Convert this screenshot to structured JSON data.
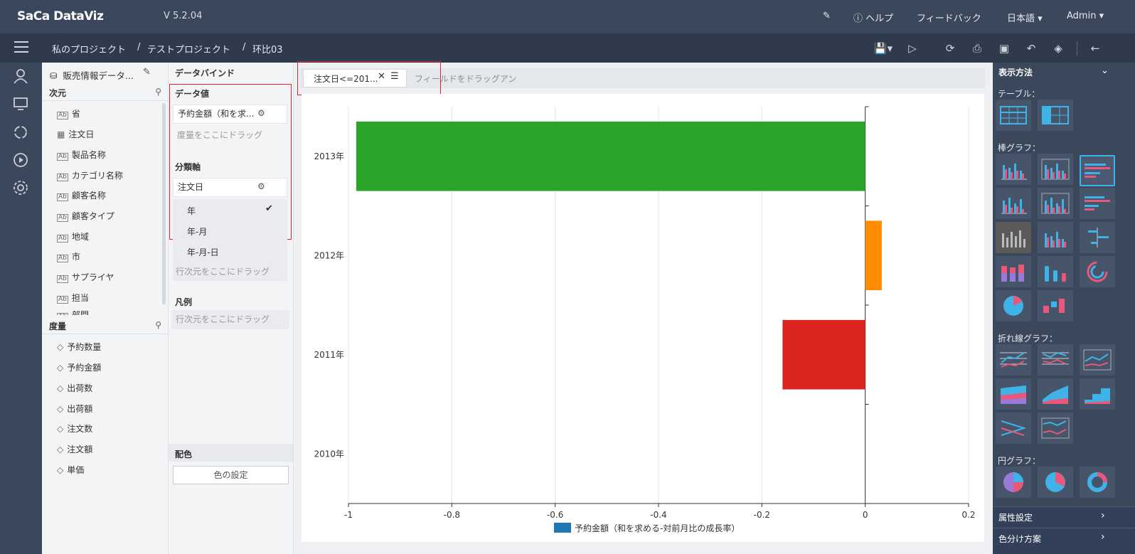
{
  "app": {
    "logo": "SaCa DataViz",
    "version": "V 5.2.04"
  },
  "topbar": {
    "help": "ヘルプ",
    "feedback": "フィードバック",
    "language": "日本語",
    "user": "Admin"
  },
  "breadcrumb": {
    "level1": "私のプロジェクト",
    "sep": "/",
    "level2": "テストプロジェクト",
    "level3": "环比03"
  },
  "dataset": {
    "name": "販売情報データ..."
  },
  "dimensions": {
    "header": "次元",
    "items": [
      "省",
      "注文日",
      "製品名称",
      "カテゴリ名称",
      "顧客名称",
      "顧客タイプ",
      "地域",
      "市",
      "サプライヤ",
      "担当",
      "部門"
    ]
  },
  "measures": {
    "header": "度量",
    "items": [
      "予約数量",
      "予約金額",
      "出荷数",
      "出荷額",
      "注文数",
      "注文額",
      "単価"
    ]
  },
  "binding": {
    "title": "データバインド",
    "value_label": "データ値",
    "value_field": "予約金額（和を求...",
    "value_placeholder": "度量をここにドラッグ",
    "axis_label": "分類軸",
    "axis_field": "注文日",
    "axis_options": [
      "年",
      "年-月",
      "年-月-日"
    ],
    "axis_placeholder": "行次元をここにドラッグ",
    "legend_label": "凡例",
    "legend_placeholder": "行次元をここにドラッグ",
    "color_label": "配色",
    "color_button": "色の設定"
  },
  "filter": {
    "chip": "注文日<=201...",
    "placeholder": "フィールドをドラッグアン"
  },
  "chart_data": {
    "type": "bar",
    "orientation": "horizontal",
    "categories": [
      "2013年",
      "2012年",
      "2011年",
      "2010年"
    ],
    "values": [
      -0.985,
      0.032,
      -0.16,
      0
    ],
    "colors": [
      "#2aa52a",
      "#ff8c00",
      "#d9241f",
      "#1f77b4"
    ],
    "xlim": [
      -1,
      0.2
    ],
    "xticks": [
      "-1",
      "-0.8",
      "-0.6",
      "-0.4",
      "-0.2",
      "0",
      "0.2"
    ],
    "legend": "予約金額（和を求める-対前月比の成長率）",
    "legend_color": "#1f77b4",
    "grid": true
  },
  "rightpanel": {
    "title": "表示方法",
    "table_label": "テーブル：",
    "bar_label": "棒グラフ：",
    "line_label": "折れ線グラフ：",
    "pie_label": "円グラフ：",
    "attr_label": "属性設定",
    "color_scheme_label": "色分け方案"
  }
}
